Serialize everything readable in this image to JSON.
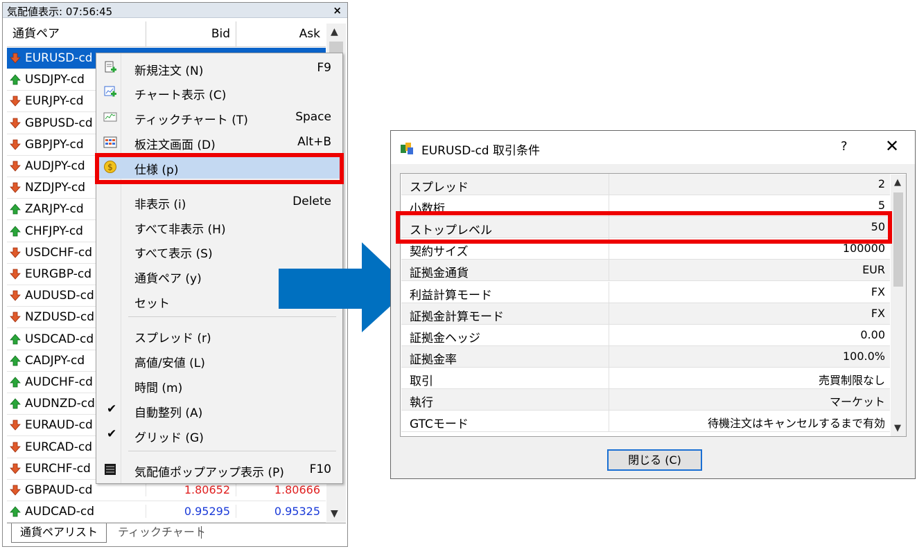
{
  "market_watch": {
    "title": "気配値表示: 07:56:45",
    "close_symbol": "×",
    "columns": {
      "symbol": "通貨ペア",
      "bid": "Bid",
      "ask": "Ask"
    },
    "rows": [
      {
        "symbol": "EURUSD-cd",
        "dir": "down",
        "bid": "",
        "ask": "",
        "color": ""
      },
      {
        "symbol": "USDJPY-cd",
        "dir": "up",
        "bid": "",
        "ask": "",
        "color": ""
      },
      {
        "symbol": "EURJPY-cd",
        "dir": "down",
        "bid": "",
        "ask": "",
        "color": ""
      },
      {
        "symbol": "GBPUSD-cd",
        "dir": "down",
        "bid": "",
        "ask": "",
        "color": ""
      },
      {
        "symbol": "GBPJPY-cd",
        "dir": "down",
        "bid": "",
        "ask": "",
        "color": ""
      },
      {
        "symbol": "AUDJPY-cd",
        "dir": "down",
        "bid": "",
        "ask": "",
        "color": ""
      },
      {
        "symbol": "NZDJPY-cd",
        "dir": "down",
        "bid": "",
        "ask": "",
        "color": ""
      },
      {
        "symbol": "ZARJPY-cd",
        "dir": "up",
        "bid": "",
        "ask": "",
        "color": ""
      },
      {
        "symbol": "CHFJPY-cd",
        "dir": "up",
        "bid": "",
        "ask": "",
        "color": ""
      },
      {
        "symbol": "USDCHF-cd",
        "dir": "down",
        "bid": "",
        "ask": "",
        "color": ""
      },
      {
        "symbol": "EURGBP-cd",
        "dir": "down",
        "bid": "",
        "ask": "",
        "color": ""
      },
      {
        "symbol": "AUDUSD-cd",
        "dir": "down",
        "bid": "",
        "ask": "",
        "color": ""
      },
      {
        "symbol": "NZDUSD-cd",
        "dir": "down",
        "bid": "",
        "ask": "",
        "color": ""
      },
      {
        "symbol": "USDCAD-cd",
        "dir": "up",
        "bid": "",
        "ask": "",
        "color": ""
      },
      {
        "symbol": "CADJPY-cd",
        "dir": "up",
        "bid": "",
        "ask": "",
        "color": ""
      },
      {
        "symbol": "AUDCHF-cd",
        "dir": "up",
        "bid": "",
        "ask": "",
        "color": ""
      },
      {
        "symbol": "AUDNZD-cd",
        "dir": "up",
        "bid": "",
        "ask": "",
        "color": ""
      },
      {
        "symbol": "EURAUD-cd",
        "dir": "down",
        "bid": "",
        "ask": "",
        "color": ""
      },
      {
        "symbol": "EURCAD-cd",
        "dir": "down",
        "bid": "",
        "ask": "",
        "color": ""
      },
      {
        "symbol": "EURCHF-cd",
        "dir": "down",
        "bid": "",
        "ask": "",
        "color": ""
      },
      {
        "symbol": "GBPAUD-cd",
        "dir": "down",
        "bid": "1.80652",
        "ask": "1.80666",
        "color": "red"
      },
      {
        "symbol": "AUDCAD-cd",
        "dir": "up",
        "bid": "0.95295",
        "ask": "0.95325",
        "color": "blue"
      }
    ],
    "tabs": [
      "通貨ペアリスト",
      "ティックチャート"
    ]
  },
  "context_menu": {
    "items": [
      {
        "label": "新規注文 (N)",
        "shortcut": "F9",
        "icon": "new-order-icon"
      },
      {
        "label": "チャート表示 (C)",
        "shortcut": "",
        "icon": "chart-window-icon"
      },
      {
        "label": "ティックチャート (T)",
        "shortcut": "Space",
        "icon": "tick-chart-icon"
      },
      {
        "label": "板注文画面 (D)",
        "shortcut": "Alt+B",
        "icon": "depth-of-market-icon"
      },
      {
        "label": "仕様 (p)",
        "shortcut": "",
        "icon": "specification-coin-icon"
      },
      {
        "label": "非表示 (i)",
        "shortcut": "Delete",
        "icon": ""
      },
      {
        "label": "すべて非表示 (H)",
        "shortcut": "",
        "icon": ""
      },
      {
        "label": "すべて表示 (S)",
        "shortcut": "",
        "icon": ""
      },
      {
        "label": "通貨ペア (y)",
        "shortcut": "",
        "icon": ""
      },
      {
        "label": "セット",
        "shortcut": "",
        "icon": ""
      },
      {
        "label": "スプレッド (r)",
        "shortcut": "",
        "icon": ""
      },
      {
        "label": "高値/安値 (L)",
        "shortcut": "",
        "icon": ""
      },
      {
        "label": "時間 (m)",
        "shortcut": "",
        "icon": ""
      },
      {
        "label": "自動整列 (A)",
        "shortcut": "",
        "icon": "",
        "checked": "✔"
      },
      {
        "label": "グリッド (G)",
        "shortcut": "",
        "icon": "",
        "checked": "✔"
      },
      {
        "label": "気配値ポップアップ表示 (P)",
        "shortcut": "F10",
        "icon": "popup-prices-icon"
      }
    ]
  },
  "dialog": {
    "title": "EURUSD-cd 取引条件",
    "help": "?",
    "close": "✕",
    "rows": [
      {
        "key": "スプレッド",
        "value": "2"
      },
      {
        "key": "小数桁",
        "value": "5"
      },
      {
        "key": "ストップレベル",
        "value": "50"
      },
      {
        "key": "契約サイズ",
        "value": "100000"
      },
      {
        "key": "証拠金通貨",
        "value": "EUR"
      },
      {
        "key": "利益計算モード",
        "value": "FX"
      },
      {
        "key": "証拠金計算モード",
        "value": "FX"
      },
      {
        "key": "証拠金ヘッジ",
        "value": "0.00"
      },
      {
        "key": "証拠金率",
        "value": "100.0%"
      },
      {
        "key": "取引",
        "value": "売買制限なし"
      },
      {
        "key": "執行",
        "value": "マーケット"
      },
      {
        "key": "GTCモード",
        "value": "待機注文はキャンセルするまで有効"
      }
    ],
    "close_button": "閉じる (C)"
  },
  "colors": {
    "highlight_box": "#ee0000",
    "arrow": "#0070c0",
    "selection": "#0a63c9"
  }
}
